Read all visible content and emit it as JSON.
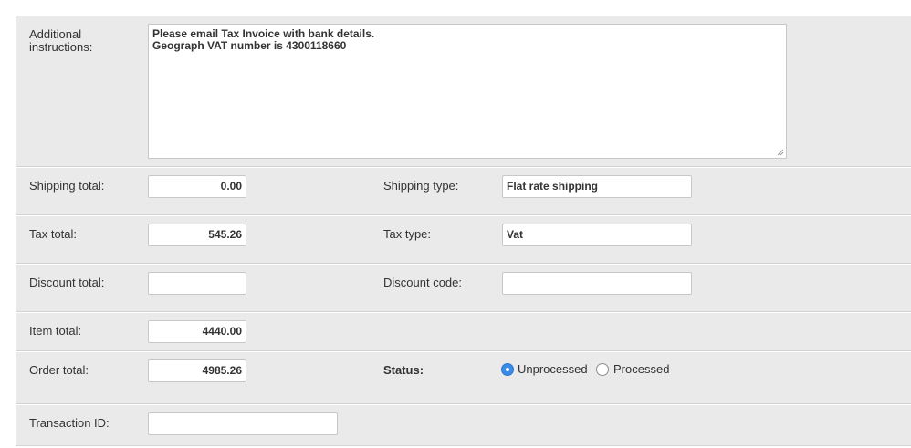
{
  "additional": {
    "label_line1": "Additional",
    "label_line2": "instructions:",
    "lines": [
      "Please email Tax Invoice with bank details.",
      "Geograph VAT number is 4300118660"
    ]
  },
  "shipping": {
    "total_label": "Shipping total:",
    "total_value": "0.00",
    "type_label": "Shipping type:",
    "type_value": "Flat rate shipping"
  },
  "tax": {
    "total_label": "Tax total:",
    "total_value": "545.26",
    "type_label": "Tax type:",
    "type_value": "Vat"
  },
  "discount": {
    "total_label": "Discount total:",
    "total_value": "",
    "code_label": "Discount code:",
    "code_value": ""
  },
  "item": {
    "total_label": "Item total:",
    "total_value": "4440.00"
  },
  "order": {
    "total_label": "Order total:",
    "total_value": "4985.26",
    "status_label": "Status:",
    "options": [
      "Unprocessed",
      "Processed"
    ],
    "selected": "Unprocessed"
  },
  "transaction": {
    "label": "Transaction ID:",
    "value": ""
  },
  "colors": {
    "panel": "#eaeaea",
    "radio_accent": "#3a8be8"
  }
}
